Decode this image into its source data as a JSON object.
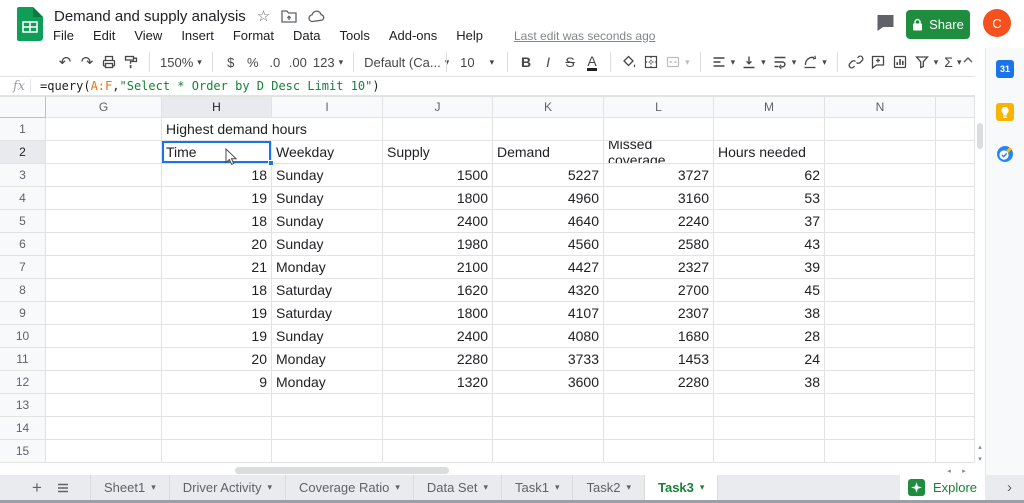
{
  "icons": {
    "dropdown": "▾",
    "star": "☆",
    "undo": "↶",
    "redo": "↷",
    "sum": "Σ",
    "plus": "+",
    "chevron_right": "›",
    "scroll_up": "▴",
    "scroll_down": "▾",
    "scroll_left": "◂",
    "scroll_right": "▸"
  },
  "titlebar": {
    "title": "Demand and supply analysis",
    "menus": [
      "File",
      "Edit",
      "View",
      "Insert",
      "Format",
      "Data",
      "Tools",
      "Add-ons",
      "Help"
    ],
    "last_edit": "Last edit was seconds ago",
    "share": "Share",
    "avatar": "C"
  },
  "toolbar": {
    "zoom": "150%",
    "currency": "$",
    "percent": "%",
    "decrease_decimal": ".0",
    "increase_decimal": ".00",
    "more_formats": "123",
    "font_family": "Default (Ca...",
    "font_size": "10",
    "bold": "B",
    "italic": "I",
    "strikethrough": "S",
    "text_color": "A"
  },
  "formula_bar": {
    "label": "fx",
    "formula": [
      {
        "text": "=query(",
        "color": "#202124"
      },
      {
        "text": "A:F",
        "color": "#e8710a"
      },
      {
        "text": ",",
        "color": "#202124"
      },
      {
        "text": "\"Select * Order by D Desc Limit 10\"",
        "color": "#188038"
      },
      {
        "text": ")",
        "color": "#202124"
      }
    ]
  },
  "grid": {
    "column_letters": [
      "G",
      "H",
      "I",
      "J",
      "K",
      "L",
      "M",
      "N"
    ],
    "row_numbers": [
      1,
      2,
      3,
      4,
      5,
      6,
      7,
      8,
      9,
      10,
      11,
      12,
      13,
      14,
      15
    ],
    "selected": {
      "column": "H",
      "row": 2
    },
    "spill_title": {
      "row": 1,
      "column": "H",
      "text": "Highest demand hours"
    },
    "table": {
      "header_row": 2,
      "first_data_row": 3,
      "start_column": "H",
      "headers": [
        "Time",
        "Weekday",
        "Supply",
        "Demand",
        "Missed coverage",
        "Hours needed"
      ],
      "rows": [
        [
          "18",
          "Sunday",
          "1500",
          "5227",
          "3727",
          "62"
        ],
        [
          "19",
          "Sunday",
          "1800",
          "4960",
          "3160",
          "53"
        ],
        [
          "18",
          "Sunday",
          "2400",
          "4640",
          "2240",
          "37"
        ],
        [
          "20",
          "Sunday",
          "1980",
          "4560",
          "2580",
          "43"
        ],
        [
          "21",
          "Monday",
          "2100",
          "4427",
          "2327",
          "39"
        ],
        [
          "18",
          "Saturday",
          "1620",
          "4320",
          "2700",
          "45"
        ],
        [
          "19",
          "Saturday",
          "1800",
          "4107",
          "2307",
          "38"
        ],
        [
          "19",
          "Sunday",
          "2400",
          "4080",
          "1680",
          "28"
        ],
        [
          "20",
          "Monday",
          "2280",
          "3733",
          "1453",
          "24"
        ],
        [
          "9",
          "Monday",
          "1320",
          "3600",
          "2280",
          "38"
        ]
      ]
    }
  },
  "tabbar": {
    "tabs": [
      {
        "label": "Sheet1",
        "active": false
      },
      {
        "label": "Driver Activity",
        "active": false
      },
      {
        "label": "Coverage Ratio",
        "active": false
      },
      {
        "label": "Data Set",
        "active": false
      },
      {
        "label": "Task1",
        "active": false
      },
      {
        "label": "Task2",
        "active": false
      },
      {
        "label": "Task3",
        "active": true
      }
    ],
    "explore": "Explore"
  },
  "side_panel": {
    "calendar_label": "31"
  },
  "colors": {
    "share_green": "#1e8e3e",
    "selection_blue": "#1a73e8",
    "avatar_orange": "#f4511e",
    "active_tab_green": "#188038",
    "formula_range_orange": "#e8710a",
    "formula_string_green": "#188038"
  }
}
